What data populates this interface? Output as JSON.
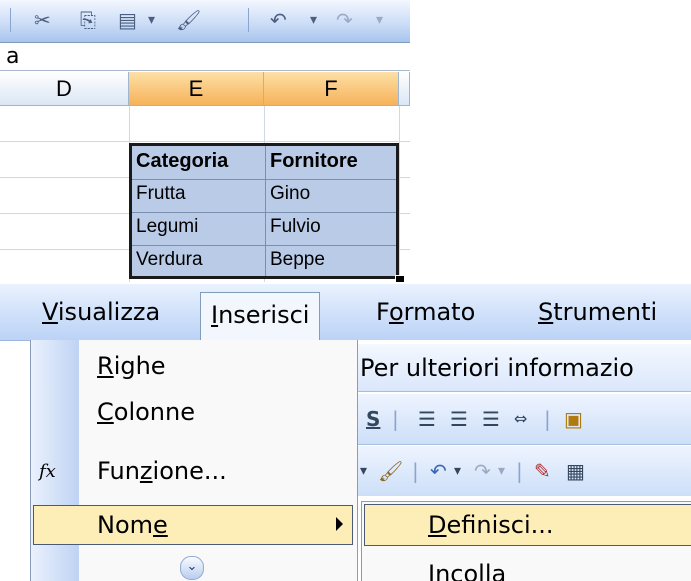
{
  "formula_bar": {
    "cell_content": "a"
  },
  "columns": [
    "D",
    "E",
    "F"
  ],
  "table": {
    "headers": [
      "Categoria",
      "Fornitore"
    ],
    "rows": [
      [
        "Frutta",
        "Gino"
      ],
      [
        "Legumi",
        "Fulvio"
      ],
      [
        "Verdura",
        "Beppe"
      ]
    ]
  },
  "toolbar_icons": [
    "cut-icon",
    "copy-icon",
    "paste-icon",
    "format-painter-icon",
    "undo-icon",
    "redo-icon"
  ],
  "menubar": {
    "items": [
      {
        "prefix": "",
        "accel": "V",
        "rest": "isualizza"
      },
      {
        "prefix": "",
        "accel": "I",
        "rest": "nserisci"
      },
      {
        "prefix": "F",
        "accel": "o",
        "rest": "rmato"
      },
      {
        "prefix": "",
        "accel": "S",
        "rest": "trumenti"
      }
    ]
  },
  "info_strip": {
    "text": "Per ulteriori informazio"
  },
  "insert_menu": {
    "items": [
      {
        "prefix": "",
        "accel": "R",
        "rest": "ighe"
      },
      {
        "prefix": "",
        "accel": "C",
        "rest": "olonne"
      },
      {
        "prefix": "Fun",
        "accel": "z",
        "rest": "ione..."
      },
      {
        "prefix": "Nom",
        "accel": "e",
        "rest": ""
      }
    ],
    "function_icon": "fx"
  },
  "name_submenu": {
    "items": [
      {
        "prefix": "",
        "accel": "D",
        "rest": "efinisci..."
      },
      {
        "prefix": "",
        "accel": "I",
        "rest": "ncolla"
      }
    ]
  },
  "format_toolbar": {
    "underline_label": "S"
  },
  "colors": {
    "selection_fill": "#b9cbe6",
    "menu_highlight": "#fdeeb8",
    "selected_col_header": "#f6b25a",
    "menubar": "#cfe0fa"
  }
}
